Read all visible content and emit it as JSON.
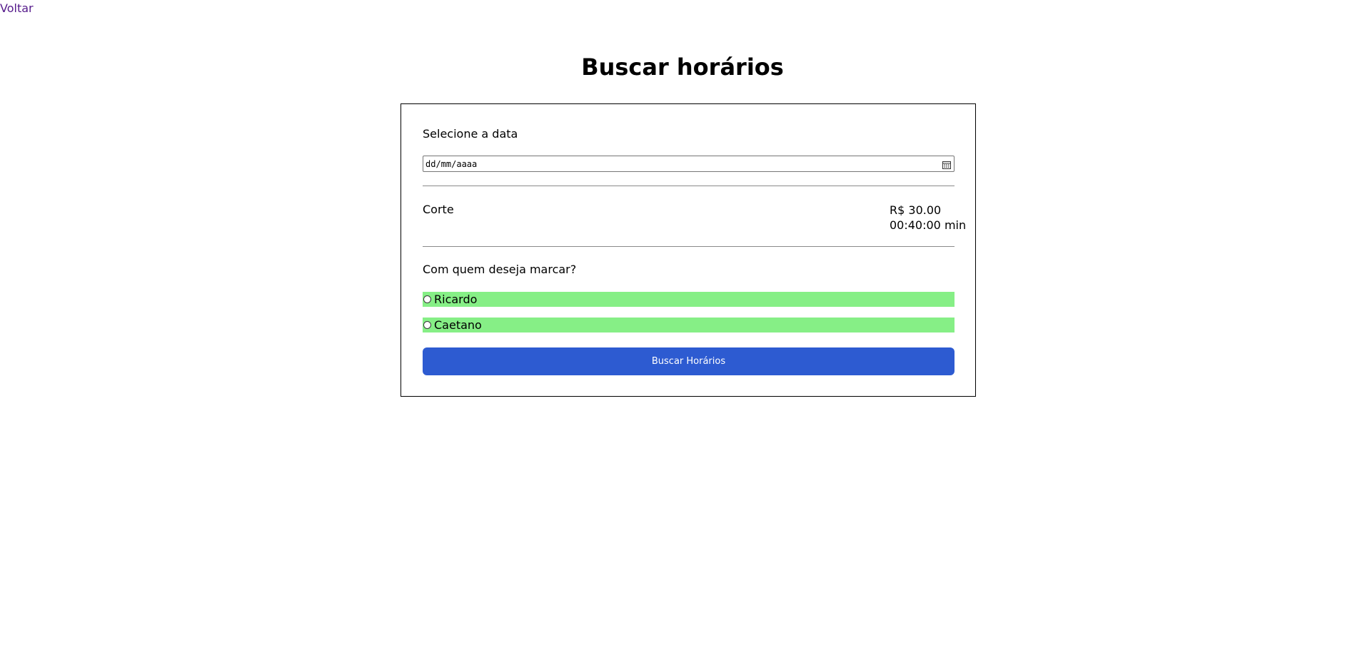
{
  "nav": {
    "back_label": "Voltar"
  },
  "page": {
    "title": "Buscar horários"
  },
  "form": {
    "date_label": "Selecione a data",
    "date_placeholder": "dd/mm/aaaa",
    "service": {
      "name": "Corte",
      "price": "R$ 30.00",
      "duration": "00:40:00 min"
    },
    "professional_label": "Com quem deseja marcar?",
    "professionals": [
      {
        "label": "Ricardo",
        "selected": false
      },
      {
        "label": "Caetano",
        "selected": false
      }
    ],
    "submit_label": "Buscar Horários"
  },
  "colors": {
    "link": "#551a8b",
    "radio_row_bg": "#86ef86",
    "button_bg": "#2d5bd1",
    "button_text": "#ffffff"
  },
  "icons": {
    "calendar": "calendar-icon",
    "radio": "radio-unchecked-icon"
  }
}
